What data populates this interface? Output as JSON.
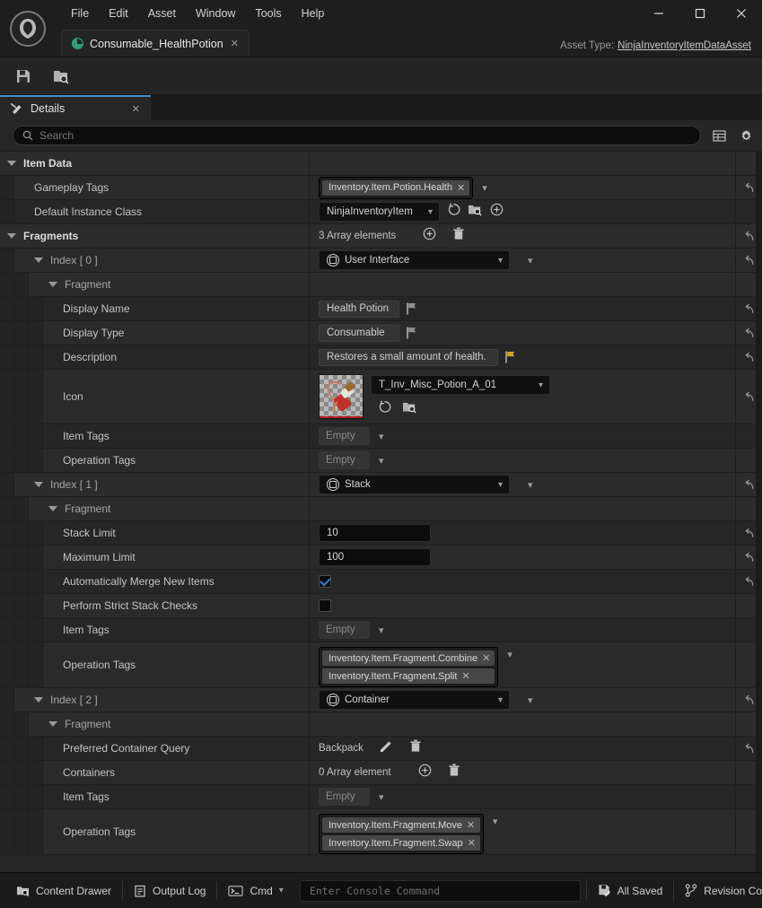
{
  "window": {
    "logo": "unreal-engine-logo",
    "menu": [
      "File",
      "Edit",
      "Asset",
      "Window",
      "Tools",
      "Help"
    ],
    "controls": {
      "minimize": "—",
      "maximize": "☐",
      "close": "✕"
    }
  },
  "tab": {
    "title": "Consumable_HealthPotion",
    "close": "✕"
  },
  "asset_type": {
    "label": "Asset Type:",
    "value": "NinjaInventoryItemDataAsset"
  },
  "toolbar": {
    "save": "save-icon",
    "browse": "browse-content-icon"
  },
  "details_panel": {
    "title": "Details",
    "close": "✕"
  },
  "search": {
    "placeholder": "Search",
    "icon": "search-icon",
    "view_options": "table-view-icon",
    "settings": "gear-icon"
  },
  "tree": {
    "item_data": {
      "label": "Item Data"
    },
    "gameplay_tags": {
      "label": "Gameplay Tags",
      "tags": [
        "Inventory.Item.Potion.Health"
      ]
    },
    "default_instance_class": {
      "label": "Default Instance Class",
      "value": "NinjaInventoryItem"
    },
    "fragments": {
      "label": "Fragments",
      "count": "3 Array elements"
    },
    "index0": {
      "label": "Index [ 0 ]",
      "type": "User Interface",
      "fragment_label": "Fragment",
      "display_name": {
        "label": "Display Name",
        "value": "Health Potion"
      },
      "display_type": {
        "label": "Display Type",
        "value": "Consumable"
      },
      "description": {
        "label": "Description",
        "value": "Restores a small amount of health."
      },
      "icon": {
        "label": "Icon",
        "value": "T_Inv_Misc_Potion_A_01"
      },
      "item_tags": {
        "label": "Item Tags",
        "value": "Empty"
      },
      "operation_tags": {
        "label": "Operation Tags",
        "value": "Empty"
      }
    },
    "index1": {
      "label": "Index [ 1 ]",
      "type": "Stack",
      "fragment_label": "Fragment",
      "stack_limit": {
        "label": "Stack Limit",
        "value": "10"
      },
      "maximum_limit": {
        "label": "Maximum Limit",
        "value": "100"
      },
      "auto_merge": {
        "label": "Automatically Merge New Items",
        "checked": true
      },
      "strict_checks": {
        "label": "Perform Strict Stack Checks",
        "checked": false
      },
      "item_tags": {
        "label": "Item Tags",
        "value": "Empty"
      },
      "operation_tags": {
        "label": "Operation Tags",
        "tags": [
          "Inventory.Item.Fragment.Combine",
          "Inventory.Item.Fragment.Split"
        ]
      }
    },
    "index2": {
      "label": "Index [ 2 ]",
      "type": "Container",
      "fragment_label": "Fragment",
      "preferred_container_query": {
        "label": "Preferred Container Query",
        "value": "Backpack"
      },
      "containers": {
        "label": "Containers",
        "count": "0 Array element"
      },
      "item_tags": {
        "label": "Item Tags",
        "value": "Empty"
      },
      "operation_tags": {
        "label": "Operation Tags",
        "tags": [
          "Inventory.Item.Fragment.Move",
          "Inventory.Item.Fragment.Swap"
        ]
      }
    }
  },
  "statusbar": {
    "content_drawer": "Content Drawer",
    "output_log": "Output Log",
    "cmd": "Cmd",
    "console_placeholder": "Enter Console Command",
    "all_saved": "All Saved",
    "revision_control": "Revision Co"
  },
  "colors": {
    "accent": "#3b8fd4",
    "tab_green": "#2f9e78",
    "checkbox_check": "#2f7fd6",
    "panel_bg": "#262626",
    "window_bg": "#1e1e1e"
  }
}
